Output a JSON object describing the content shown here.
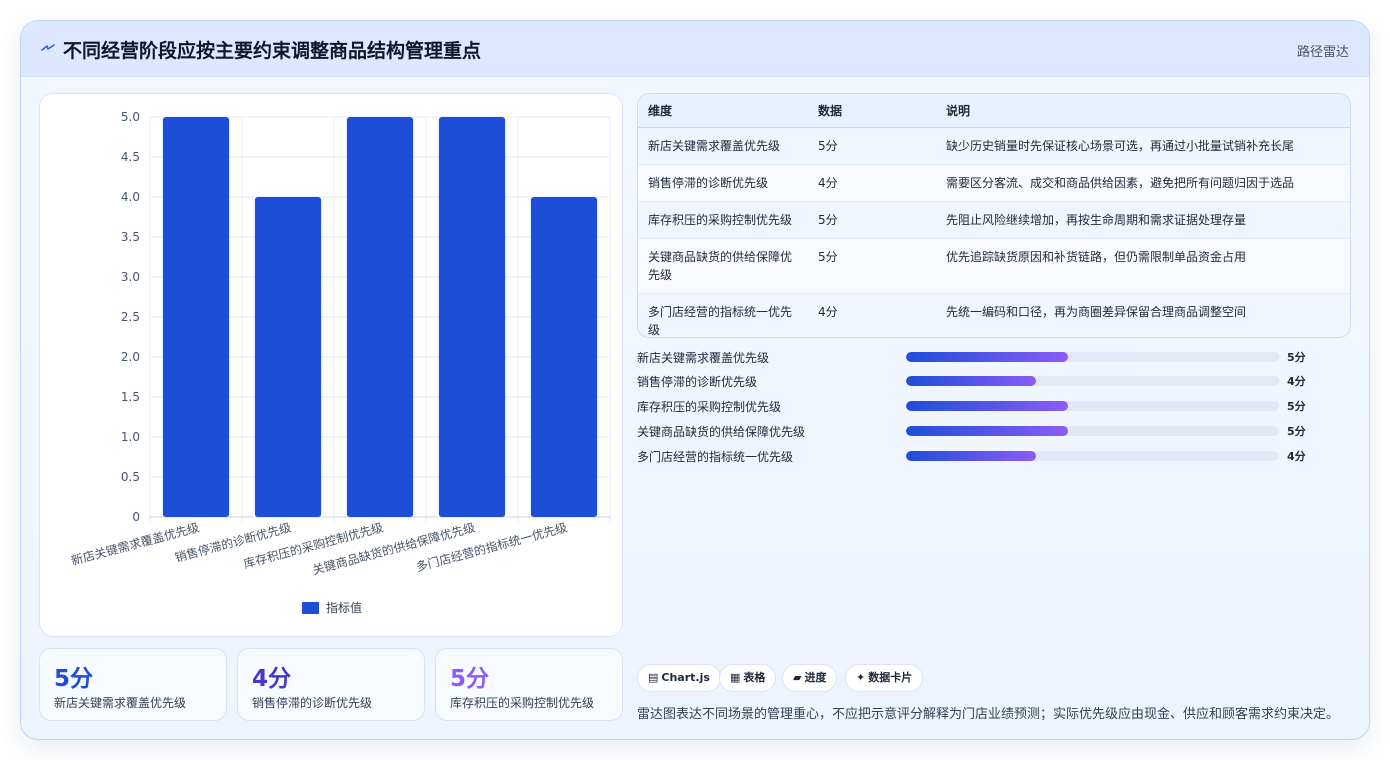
{
  "header": {
    "icon": "lightning-icon",
    "title": "不同经营阶段应按主要约束调整商品结构管理重点",
    "tag": "路径雷达"
  },
  "chart_data": {
    "type": "bar",
    "categories": [
      "新店关键需求覆盖优先级",
      "销售停滞的诊断优先级",
      "库存积压的采购控制优先级",
      "关键商品缺货的供给保障优先级",
      "多门店经营的指标统一优先级"
    ],
    "series": [
      {
        "name": "指标值",
        "values": [
          5,
          4,
          5,
          5,
          4
        ]
      }
    ],
    "ylim": [
      0,
      5
    ],
    "yticks": [
      "0",
      "0.5",
      "1.0",
      "1.5",
      "2.0",
      "2.5",
      "3.0",
      "3.5",
      "4.0",
      "4.5",
      "5.0"
    ],
    "color": "#1d4ed8",
    "grid": true,
    "legend": "bottom"
  },
  "stats": [
    {
      "value": "5分",
      "label": "新店关键需求覆盖优先级",
      "color": "#1d4ed8"
    },
    {
      "value": "4分",
      "label": "销售停滞的诊断优先级",
      "color": "#4338ca"
    },
    {
      "value": "5分",
      "label": "库存积压的采购控制优先级",
      "color": "#8b5cf6"
    }
  ],
  "table": {
    "headers": [
      "维度",
      "数据",
      "说明"
    ],
    "rows": [
      [
        "新店关键需求覆盖优先级",
        "5分",
        "缺少历史销量时先保证核心场景可选，再通过小批量试销补充长尾"
      ],
      [
        "销售停滞的诊断优先级",
        "4分",
        "需要区分客流、成交和商品供给因素，避免把所有问题归因于选品"
      ],
      [
        "库存积压的采购控制优先级",
        "5分",
        "先阻止风险继续增加，再按生命周期和需求证据处理存量"
      ],
      [
        "关键商品缺货的供给保障优先级",
        "5分",
        "优先追踪缺货原因和补货链路，但仍需限制单品资金占用"
      ],
      [
        "多门店经营的指标统一优先级",
        "4分",
        "先统一编码和口径，再为商圈差异保留合理商品调整空间"
      ]
    ]
  },
  "progress": [
    {
      "label": "新店关键需求覆盖优先级",
      "value": "5分",
      "fraction": 0.434
    },
    {
      "label": "销售停滞的诊断优先级",
      "value": "4分",
      "fraction": 0.348
    },
    {
      "label": "库存积压的采购控制优先级",
      "value": "5分",
      "fraction": 0.434
    },
    {
      "label": "关键商品缺货的供给保障优先级",
      "value": "5分",
      "fraction": 0.434
    },
    {
      "label": "多门店经营的指标统一优先级",
      "value": "4分",
      "fraction": 0.348
    }
  ],
  "pills": [
    {
      "icon": "chart-icon",
      "label": "Chart.js"
    },
    {
      "icon": "table-icon",
      "label": "表格"
    },
    {
      "icon": "progress-icon",
      "label": "进度"
    },
    {
      "icon": "sparkle-icon",
      "label": "数据卡片"
    }
  ],
  "footnote": "雷达图表达不同场景的管理重心，不应把示意评分解释为门店业绩预测；实际优先级应由现金、供应和顾客需求约束决定。"
}
